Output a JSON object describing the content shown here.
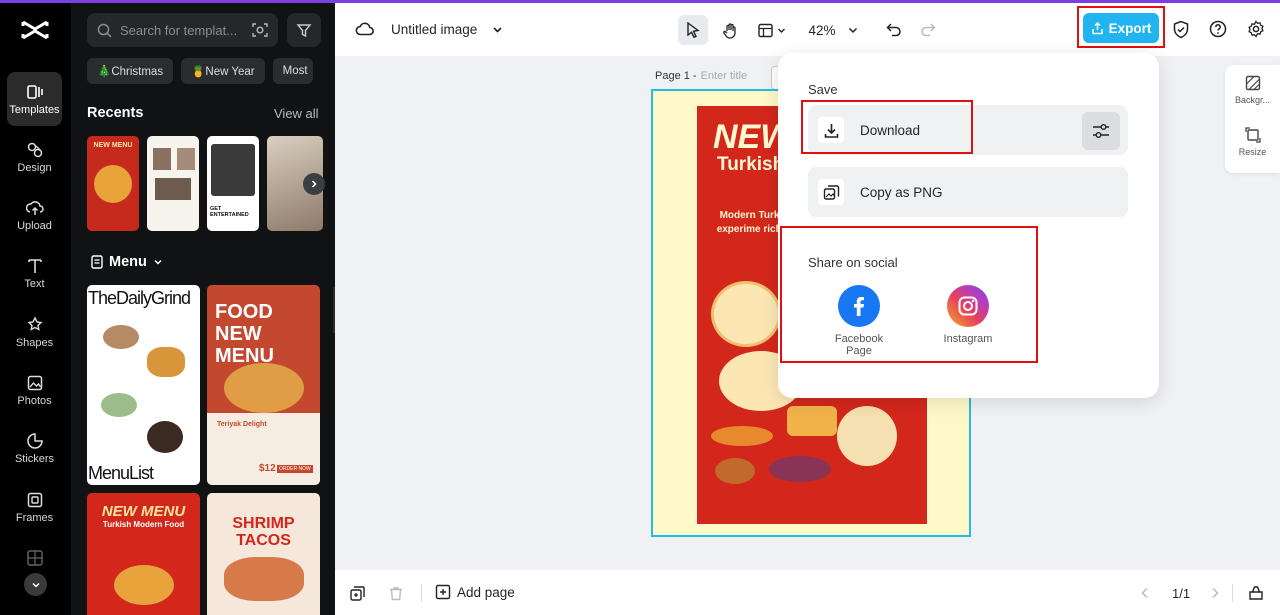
{
  "rail": {
    "items": [
      {
        "label": "Templates",
        "icon": "templates-icon"
      },
      {
        "label": "Design",
        "icon": "design-icon"
      },
      {
        "label": "Upload",
        "icon": "upload-icon"
      },
      {
        "label": "Text",
        "icon": "text-icon"
      },
      {
        "label": "Shapes",
        "icon": "shapes-icon"
      },
      {
        "label": "Photos",
        "icon": "photos-icon"
      },
      {
        "label": "Stickers",
        "icon": "stickers-icon"
      },
      {
        "label": "Frames",
        "icon": "frames-icon"
      }
    ]
  },
  "panel": {
    "search_placeholder": "Search for templat...",
    "chips": [
      "🎄Christmas",
      "🍍New Year",
      "Most"
    ],
    "recents_title": "Recents",
    "view_all": "View all",
    "menu_title": "Menu",
    "templates": {
      "daily_grind_title": "TheDailyGrind",
      "daily_grind_footer": "MenuList",
      "food_new_menu": "FOOD NEW MENU",
      "teriyaki": "Teriyak Delight",
      "price": "$12",
      "order_now": "ORDER NOW",
      "new_menu": "NEW MENU",
      "turkish_modern": "Turkish Modern Food",
      "shrimp_tacos": "SHRIMP TACOS",
      "recent_new_menu": "NEW MENU",
      "recent_get_entertained": "GET ENTERTAINED"
    }
  },
  "topbar": {
    "doc_title": "Untitled image",
    "zoom": "42%",
    "export_label": "Export"
  },
  "canvas": {
    "page_label": "Page 1 -",
    "enter_title": "Enter title",
    "poster_line1": "NEW",
    "poster_line2": "Turkish",
    "poster_body": "Modern Turkish and experime rich culinar"
  },
  "side_panel": {
    "background": "Backgr...",
    "resize": "Resize"
  },
  "bottombar": {
    "add_page": "Add page",
    "pages": "1/1"
  },
  "dropdown": {
    "save_label": "Save",
    "download": "Download",
    "copy_png": "Copy as PNG",
    "share_label": "Share on social",
    "facebook": "Facebook Page",
    "instagram": "Instagram"
  },
  "colors": {
    "accent": "#21b4f0",
    "highlight": "#e01010",
    "poster": "#d3271c",
    "artboard_border": "#22bde0"
  }
}
